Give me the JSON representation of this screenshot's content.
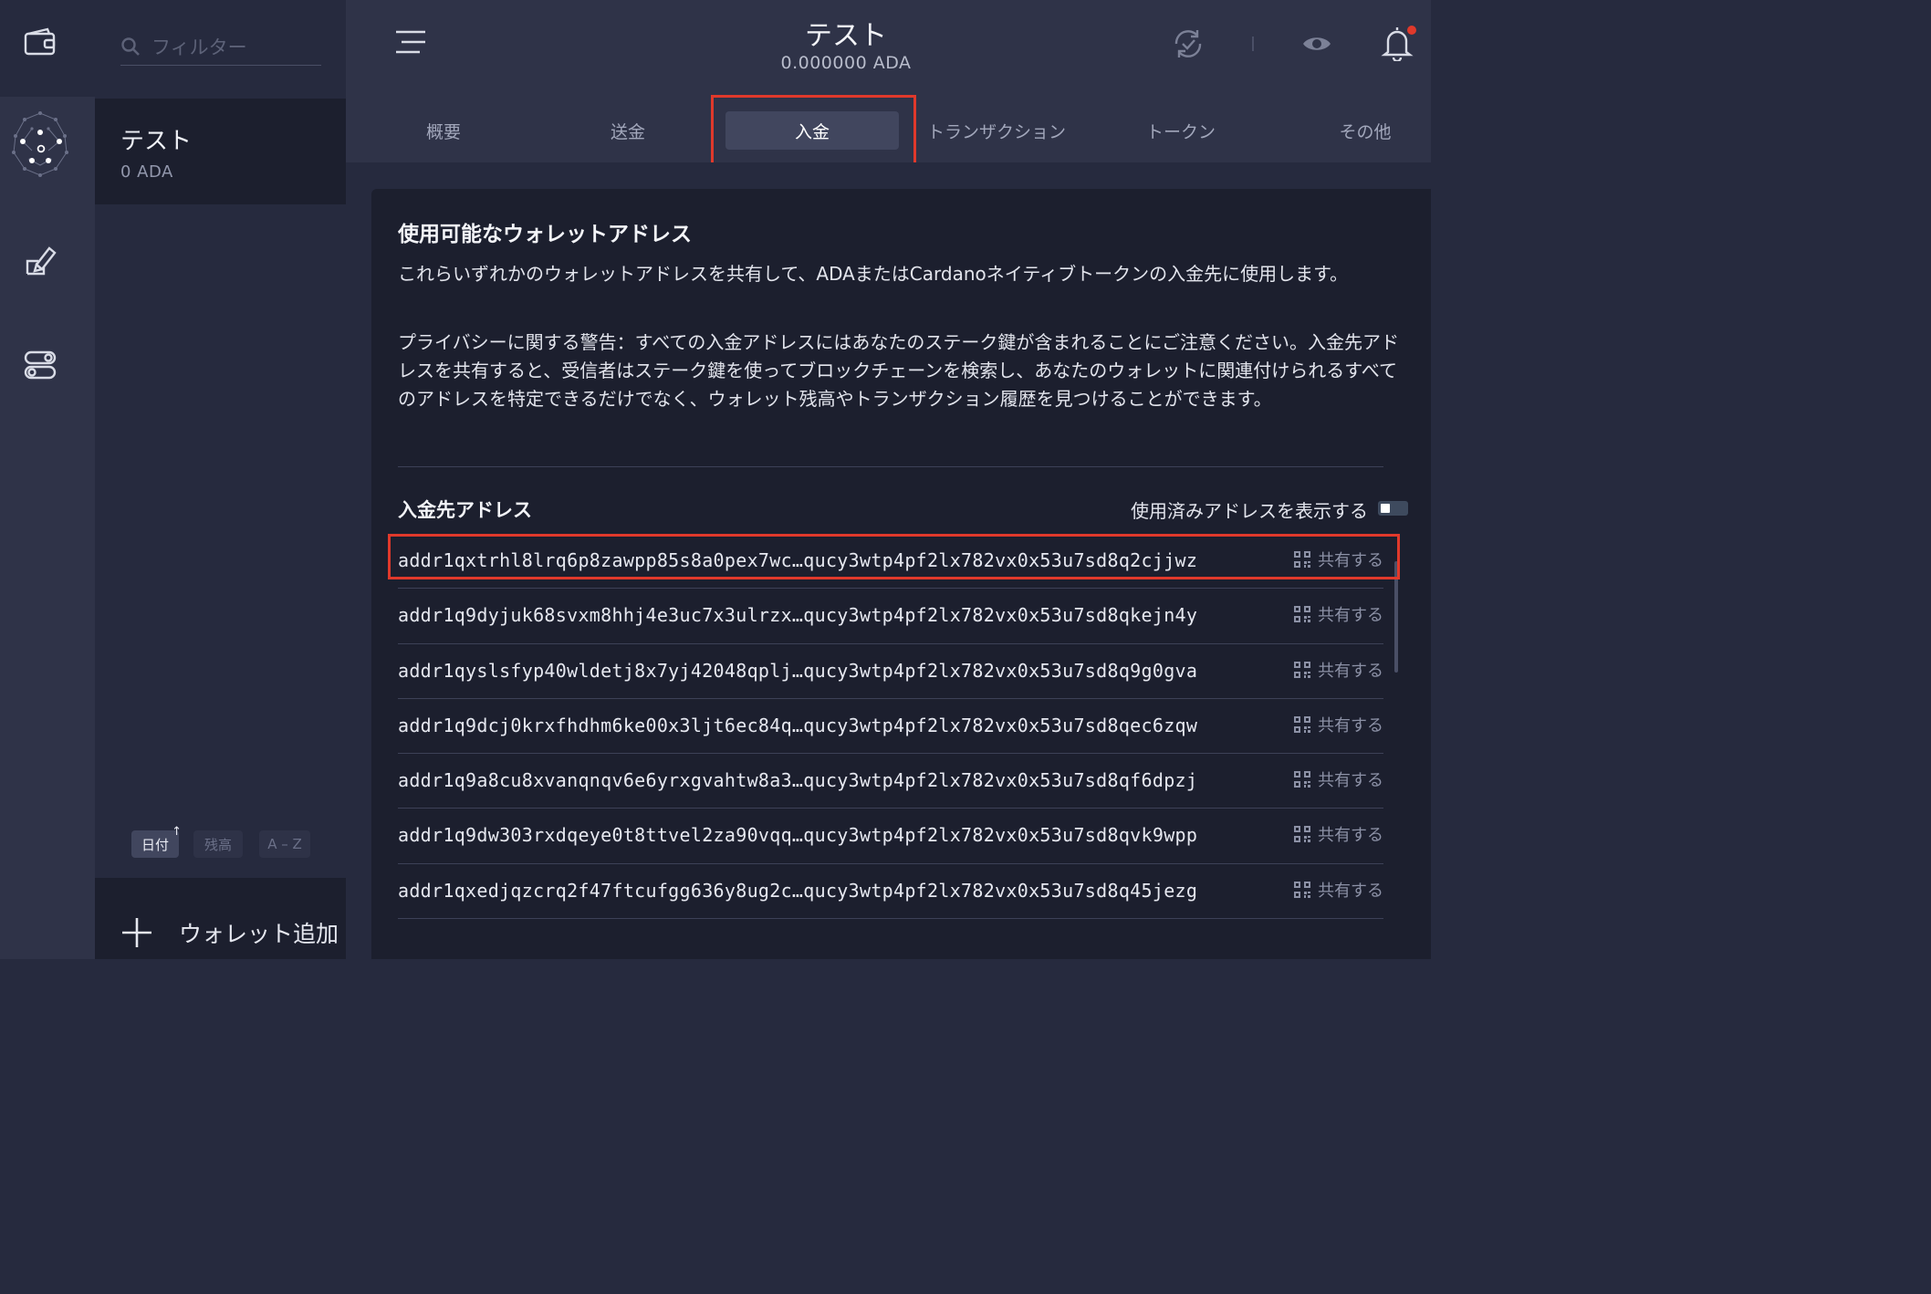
{
  "search": {
    "placeholder": "フィルター"
  },
  "wallet_list": {
    "items": [
      {
        "name": "テスト",
        "balance": "0 ADA"
      }
    ],
    "sort": [
      {
        "label": "日付",
        "active": true
      },
      {
        "label": "残高",
        "active": false
      },
      {
        "label": "A – Z",
        "active": false
      }
    ],
    "add_label": "ウォレット追加"
  },
  "header": {
    "title": "テスト",
    "balance": "0.000000 ADA"
  },
  "tabs": [
    {
      "label": "概要"
    },
    {
      "label": "送金"
    },
    {
      "label": "入金"
    },
    {
      "label": "トランザクション"
    },
    {
      "label": "トークン"
    },
    {
      "label": "その他"
    }
  ],
  "active_tab": "入金",
  "receive": {
    "heading": "使用可能なウォレットアドレス",
    "description": "これらいずれかのウォレットアドレスを共有して、ADAまたはCardanoネイティブトークンの入金先に使用します。",
    "privacy_warning": "プライバシーに関する警告：すべての入金アドレスにはあなたのステーク鍵が含まれることにご注意ください。入金先アドレスを共有すると、受信者はステーク鍵を使ってブロックチェーンを検索し、あなたのウォレットに関連付けられるすべてのアドレスを特定できるだけでなく、ウォレット残高やトランザクション履歴を見つけることができます。",
    "section_title": "入金先アドレス",
    "toggle_label": "使用済みアドレスを表示する",
    "share_label": "共有する",
    "addresses": [
      "addr1qxtrhl8lrq6p8zawpp85s8a0pex7wc…qucy3wtp4pf2lx782vx0x53u7sd8q2cjjwz",
      "addr1q9dyjuk68svxm8hhj4e3uc7x3ulrzx…qucy3wtp4pf2lx782vx0x53u7sd8qkejn4y",
      "addr1qyslsfyp40wldetj8x7yj42048qplj…qucy3wtp4pf2lx782vx0x53u7sd8q9g0gva",
      "addr1q9dcj0krxfhdhm6ke00x3ljt6ec84q…qucy3wtp4pf2lx782vx0x53u7sd8qec6zqw",
      "addr1q9a8cu8xvanqnqv6e6yrxgvahtw8a3…qucy3wtp4pf2lx782vx0x53u7sd8qf6dpzj",
      "addr1q9dw303rxdqeye0t8ttvel2za90vqq…qucy3wtp4pf2lx782vx0x53u7sd8qvk9wpp",
      "addr1qxedjqzcrq2f47ftcufgg636y8ug2c…qucy3wtp4pf2lx782vx0x53u7sd8q45jezg"
    ]
  },
  "colors": {
    "highlight": "#e0392b",
    "sidebar_bg": "#2f3348",
    "card_bg": "#1c1f2e",
    "notification_dot": "#e0392b"
  },
  "icons": {
    "wallets": "wallet-icon",
    "staking": "network-icon",
    "voting": "ballot-icon",
    "settings": "toggles-icon",
    "menu": "hamburger-icon",
    "sync": "sync-check-icon",
    "privacy": "eye-icon",
    "notifications": "bell-icon",
    "share": "qr-code-icon"
  }
}
